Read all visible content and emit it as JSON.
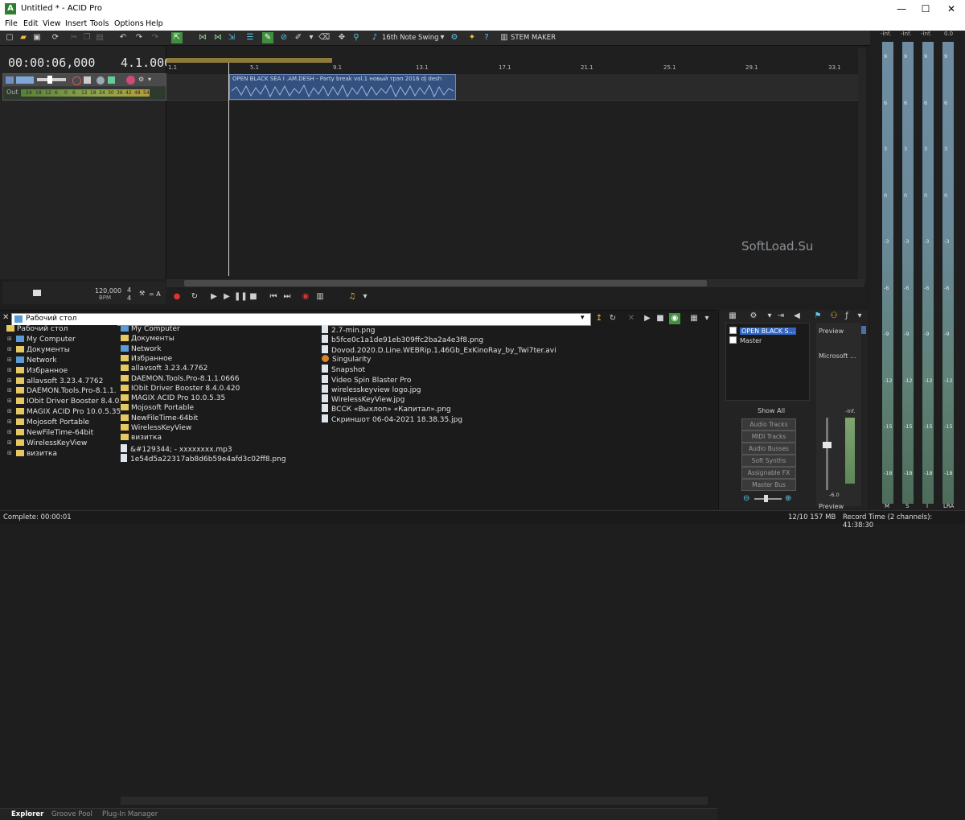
{
  "window": {
    "title": "Untitled * - ACID Pro",
    "minimize": "—",
    "maximize": "☐",
    "close": "✕",
    "logo_letter": "A"
  },
  "menu": [
    "File",
    "Edit",
    "View",
    "Insert",
    "Tools",
    "Options",
    "Help"
  ],
  "toolbar": {
    "swing_label": "16th Note Swing",
    "stem_label": "STEM MAKER"
  },
  "transport": {
    "time": "00:00:06,000",
    "beats": "4.1.000",
    "bpm_value": "120,000",
    "bpm_label": "BPM",
    "time_sig_top": "4",
    "time_sig_bottom": "4",
    "key_label": "= A"
  },
  "track": {
    "out_label": "Out",
    "meter_ticks": [
      "24",
      "18",
      "12",
      "6",
      "0",
      "6",
      "12",
      "18",
      "24",
      "30",
      "36",
      "42",
      "48",
      "54"
    ]
  },
  "ruler": [
    "1.1",
    "5.1",
    "9.1",
    "13.1",
    "17.1",
    "21.1",
    "25.1",
    "29.1",
    "33.1"
  ],
  "clip": {
    "name": "OPEN BLACK SEA I .AM.DESH - Party break vol.1 новый трэп 2016 dj desh"
  },
  "explorer": {
    "path": "Рабочий стол",
    "tree": [
      {
        "label": "Рабочий стол",
        "kind": "folder",
        "indent": 0
      },
      {
        "label": "My Computer",
        "kind": "computer",
        "indent": 1
      },
      {
        "label": "Документы",
        "kind": "folder",
        "indent": 1
      },
      {
        "label": "Network",
        "kind": "computer",
        "indent": 1
      },
      {
        "label": "Избранное",
        "kind": "folder",
        "indent": 1
      },
      {
        "label": "allavsoft 3.23.4.7762",
        "kind": "folder",
        "indent": 1
      },
      {
        "label": "DAEMON.Tools.Pro-8.1.1.",
        "kind": "folder",
        "indent": 1
      },
      {
        "label": "IObit Driver Booster 8.4.0.",
        "kind": "folder",
        "indent": 1
      },
      {
        "label": "MAGIX ACID Pro 10.0.5.35",
        "kind": "folder",
        "indent": 1
      },
      {
        "label": "Mojosoft Portable",
        "kind": "folder",
        "indent": 1
      },
      {
        "label": "NewFileTime-64bit",
        "kind": "folder",
        "indent": 1
      },
      {
        "label": "WirelessKeyView",
        "kind": "folder",
        "indent": 1
      },
      {
        "label": "визитка",
        "kind": "folder",
        "indent": 1
      }
    ],
    "files_col1": [
      {
        "label": "My Computer",
        "kind": "computer"
      },
      {
        "label": "Документы",
        "kind": "folder"
      },
      {
        "label": "Network",
        "kind": "computer"
      },
      {
        "label": "Избранное",
        "kind": "folder"
      },
      {
        "label": "allavsoft 3.23.4.7762",
        "kind": "folder"
      },
      {
        "label": "DAEMON.Tools.Pro-8.1.1.0666",
        "kind": "folder"
      },
      {
        "label": "IObit Driver Booster 8.4.0.420",
        "kind": "folder"
      },
      {
        "label": "MAGIX ACID Pro 10.0.5.35",
        "kind": "folder"
      },
      {
        "label": "Mojosoft Portable",
        "kind": "folder"
      },
      {
        "label": "NewFileTime-64bit",
        "kind": "folder"
      },
      {
        "label": "WirelessKeyView",
        "kind": "folder"
      },
      {
        "label": "визитка",
        "kind": "folder"
      },
      {
        "label": "&#129344; - xxxxxxxx.mp3",
        "kind": "file"
      },
      {
        "label": "1e54d5a22317ab8d6b59e4afd3c02ff8.png",
        "kind": "file"
      }
    ],
    "files_col2": [
      {
        "label": "2.7-min.png",
        "kind": "file"
      },
      {
        "label": "b5fce0c1a1de91eb309ffc2ba2a4e3f8.png",
        "kind": "file"
      },
      {
        "label": "Dovod.2020.D.Line.WEBRip.1.46Gb_ExKinoRay_by_Twi7ter.avi",
        "kind": "file"
      },
      {
        "label": "Singularity",
        "kind": "app"
      },
      {
        "label": "Snapshot",
        "kind": "file"
      },
      {
        "label": "Video Spin Blaster Pro",
        "kind": "file"
      },
      {
        "label": "wirelesskeyview logo.jpg",
        "kind": "file"
      },
      {
        "label": "WirelessKeyView.jpg",
        "kind": "file"
      },
      {
        "label": "ВССК «Выхлоп» «Капитал».png",
        "kind": "file"
      },
      {
        "label": "Скриншот 06-04-2021 18.38.35.jpg",
        "kind": "file"
      }
    ],
    "tabs": [
      "Explorer",
      "Groove Pool",
      "Plug-In Manager"
    ]
  },
  "mixer": {
    "busses": [
      {
        "label": "OPEN BLACK S...",
        "selected": true
      },
      {
        "label": "Master",
        "selected": false
      }
    ],
    "show_all": "Show All",
    "filters": [
      "Audio Tracks",
      "MIDI Tracks",
      "Audio Busses",
      "Soft Synths",
      "Assignable FX",
      "Master Bus"
    ],
    "preview_label": "Preview",
    "device_label": "Microsoft ...",
    "preview_db": "-Inf.",
    "fader_value": "-6.0",
    "preview_bottom": "Preview"
  },
  "master_meters": {
    "top_labels": [
      "-Inf.",
      "-Inf.",
      "-Inf.",
      "0.0"
    ],
    "bottom_labels": [
      "M",
      "S",
      "I",
      "LRA"
    ],
    "scale": [
      "9",
      "6",
      "3",
      "0",
      "-3",
      "-6",
      "-9",
      "-12",
      "-15",
      "-18"
    ]
  },
  "status": {
    "left": "Complete: 00:00:01",
    "mid": "12/10 157 MB",
    "right": "Record Time (2 channels): 41:38:30"
  },
  "watermark": "SoftLoad.Su"
}
